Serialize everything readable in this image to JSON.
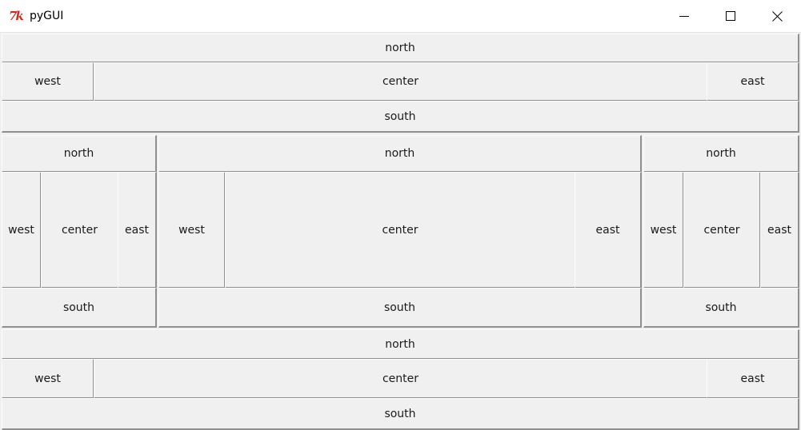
{
  "window": {
    "title": "pyGUI",
    "icon": "tk-icon",
    "controls": [
      "minimize",
      "maximize",
      "close"
    ]
  },
  "top_frame": {
    "north": "north",
    "west": "west",
    "center": "center",
    "east": "east",
    "south": "south"
  },
  "middle_frames": [
    {
      "north": "north",
      "west": "west",
      "center": "center",
      "east": "east",
      "south": "south"
    },
    {
      "north": "north",
      "west": "west",
      "center": "center",
      "east": "east",
      "south": "south"
    },
    {
      "north": "north",
      "west": "west",
      "center": "center",
      "east": "east",
      "south": "south"
    }
  ],
  "bottom_frame": {
    "north": "north",
    "west": "west",
    "center": "center",
    "east": "east",
    "south": "south"
  }
}
